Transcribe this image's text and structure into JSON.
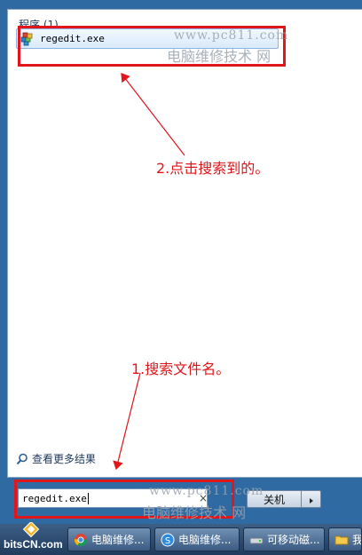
{
  "results": {
    "section_header": "程序 (1)",
    "item_label": "regedit.exe",
    "icon": "regedit-icon"
  },
  "annotations": {
    "step2": "2.点击搜索到的。",
    "step1": "1.搜索文件名。",
    "color": "#e0161b"
  },
  "watermark": {
    "url": "www.pc811.com",
    "text": "电脑维修技术 网"
  },
  "more_results": {
    "label": "查看更多结果",
    "icon": "magnifier-icon"
  },
  "search": {
    "value": "regedit.exe",
    "clear_glyph": "×"
  },
  "shutdown": {
    "label": "关机",
    "arrow_icon": "chevron-right-icon"
  },
  "taskbar": {
    "brand": "bitsCN.com",
    "buttons": [
      {
        "label": "电脑维修...",
        "icon": "chrome-icon"
      },
      {
        "label": "电脑维修...",
        "icon": "browser-s-icon"
      },
      {
        "label": "可移动磁...",
        "icon": "drive-icon"
      },
      {
        "label": "我",
        "icon": "folder-icon"
      }
    ]
  }
}
